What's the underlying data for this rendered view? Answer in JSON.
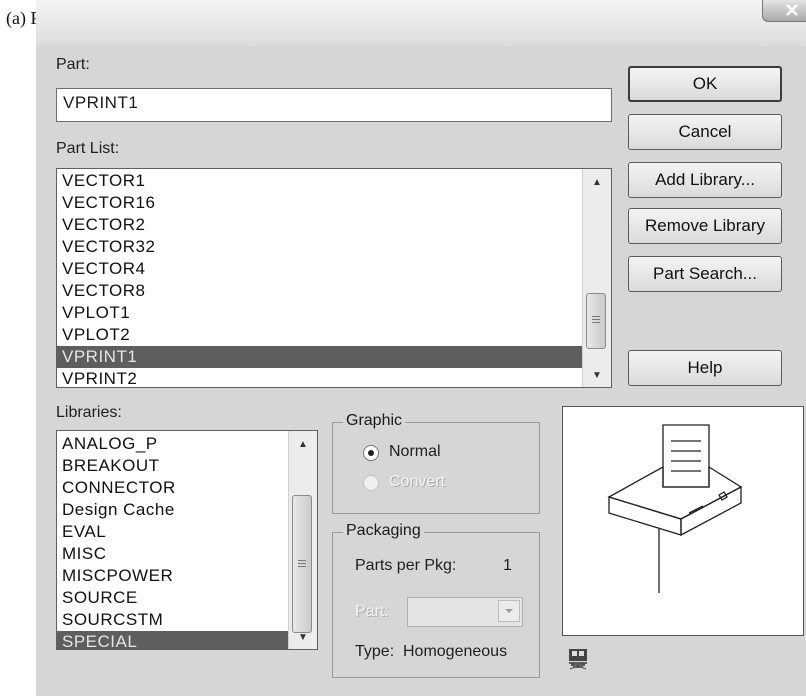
{
  "caption": "(a) Place Part",
  "window": {
    "close_icon": "close-x-icon"
  },
  "part": {
    "label": "Part:",
    "value": "VPRINT1"
  },
  "part_list": {
    "label": "Part List:",
    "items": [
      "VECTOR1",
      "VECTOR16",
      "VECTOR2",
      "VECTOR32",
      "VECTOR4",
      "VECTOR8",
      "VPLOT1",
      "VPLOT2",
      "VPRINT1",
      "VPRINT2"
    ],
    "selected": "VPRINT1"
  },
  "libraries": {
    "label": "Libraries:",
    "items": [
      "ANALOG_P",
      "BREAKOUT",
      "CONNECTOR",
      "Design Cache",
      "EVAL",
      "MISC",
      "MISCPOWER",
      "SOURCE",
      "SOURCSTM",
      "SPECIAL"
    ],
    "selected": "SPECIAL"
  },
  "buttons": {
    "ok": "OK",
    "cancel": "Cancel",
    "add_library": "Add Library...",
    "remove_library": "Remove Library",
    "part_search": "Part Search...",
    "help": "Help"
  },
  "graphic": {
    "title": "Graphic",
    "normal": "Normal",
    "convert": "Convert",
    "selected": "Normal"
  },
  "packaging": {
    "title": "Packaging",
    "parts_per_pkg_label": "Parts per Pkg:",
    "parts_per_pkg_value": "1",
    "part_label": "Part:",
    "type_label": "Type:",
    "type_value": "Homogeneous"
  },
  "preview": {
    "symbol": "printer-symbol",
    "footprint_icon": "footprint-icon"
  }
}
